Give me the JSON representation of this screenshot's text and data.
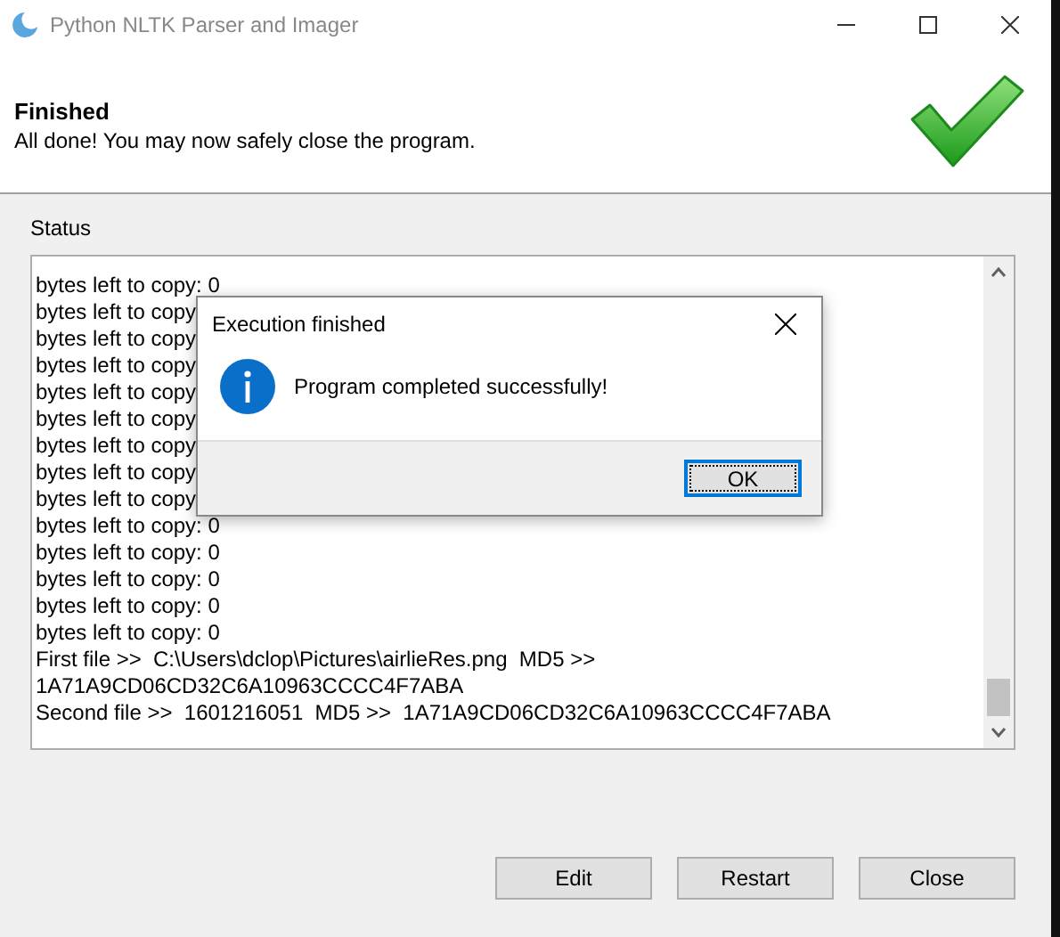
{
  "window": {
    "title": "Python NLTK Parser and Imager"
  },
  "header": {
    "title": "Finished",
    "subtitle": "All done! You may now safely close the program."
  },
  "status": {
    "label": "Status",
    "lines": [
      "bytes left to copy: 0",
      "bytes left to copy",
      "bytes left to copy",
      "bytes left to copy",
      "bytes left to copy",
      "bytes left to copy",
      "bytes left to copy",
      "bytes left to copy",
      "bytes left to copy",
      "bytes left to copy: 0",
      "bytes left to copy: 0",
      "bytes left to copy: 0",
      "bytes left to copy: 0",
      "bytes left to copy: 0",
      "First file >>  C:\\Users\\dclop\\Pictures\\airlieRes.png  MD5 >>",
      "1A71A9CD06CD32C6A10963CCCC4F7ABA",
      "Second file >>  1601216051  MD5 >>  1A71A9CD06CD32C6A10963CCCC4F7ABA"
    ]
  },
  "buttons": [
    "Edit",
    "Restart",
    "Close"
  ],
  "dialog": {
    "title": "Execution finished",
    "message": "Program completed successfully!",
    "buttons": [
      {
        "label": "OK",
        "selected": true
      }
    ]
  }
}
